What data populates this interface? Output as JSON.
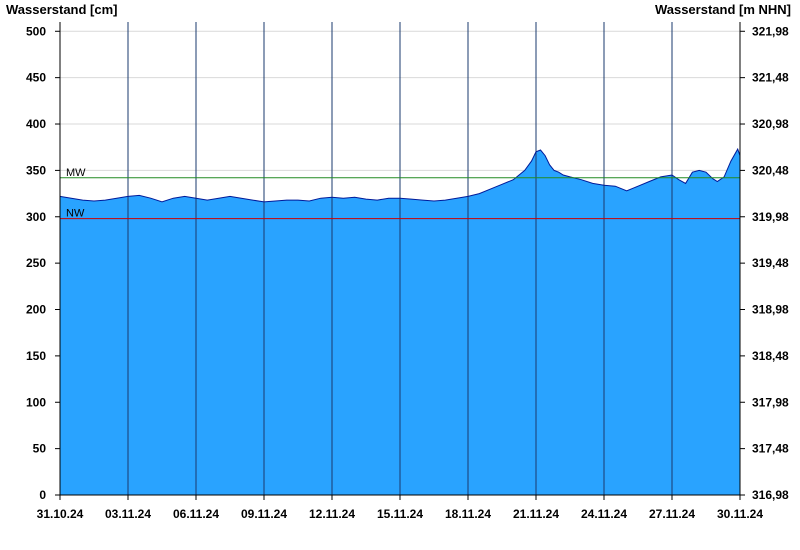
{
  "chart_data": {
    "type": "area",
    "y_left_label": "Wasserstand [cm]",
    "y_right_label": "Wasserstand [m NHN]",
    "ylim": [
      0,
      510
    ],
    "y_ticks": [
      0,
      50,
      100,
      150,
      200,
      250,
      300,
      350,
      400,
      450,
      500
    ],
    "y_ticks_labels": [
      "0",
      "50",
      "100",
      "150",
      "200",
      "250",
      "300",
      "350",
      "400",
      "450",
      "500"
    ],
    "y_right_ticks_labels": [
      "316,98",
      "317,48",
      "317,98",
      "318,48",
      "318,98",
      "319,48",
      "319,98",
      "320,48",
      "320,98",
      "321,48",
      "321,98"
    ],
    "x_start": "31.10.24",
    "x_days": 30,
    "x_tick_days": [
      0,
      3,
      6,
      9,
      12,
      15,
      18,
      21,
      24,
      27,
      30
    ],
    "x_ticks_labels": [
      "31.10.24",
      "03.11.24",
      "06.11.24",
      "09.11.24",
      "12.11.24",
      "15.11.24",
      "18.11.24",
      "21.11.24",
      "24.11.24",
      "27.11.24",
      "30.11.24"
    ],
    "grid": true,
    "fill_color": "#29a3ff",
    "line_color": "#001a99",
    "x": [
      0,
      0.5,
      1,
      1.5,
      2,
      2.5,
      3,
      3.5,
      4,
      4.5,
      5,
      5.5,
      6,
      6.5,
      7,
      7.5,
      8,
      8.5,
      9,
      9.5,
      10,
      10.5,
      11,
      11.5,
      12,
      12.5,
      13,
      13.5,
      14,
      14.5,
      15,
      15.5,
      16,
      16.5,
      17,
      17.5,
      18,
      18.5,
      19,
      19.5,
      20,
      20.5,
      20.8,
      21,
      21.2,
      21.4,
      21.6,
      21.8,
      22,
      22.2,
      22.5,
      23,
      23.5,
      24,
      24.5,
      25,
      25.5,
      26,
      26.5,
      27,
      27.3,
      27.6,
      27.9,
      28.2,
      28.5,
      28.8,
      29,
      29.3,
      29.6,
      29.9,
      30.2,
      30.5,
      30.8,
      30.9
    ],
    "values": [
      322,
      320,
      318,
      317,
      318,
      320,
      322,
      323,
      320,
      316,
      320,
      322,
      320,
      318,
      320,
      322,
      320,
      318,
      316,
      317,
      318,
      318,
      317,
      320,
      321,
      320,
      321,
      319,
      318,
      320,
      320,
      319,
      318,
      317,
      318,
      320,
      322,
      325,
      330,
      335,
      340,
      350,
      360,
      370,
      372,
      366,
      356,
      350,
      348,
      345,
      343,
      340,
      336,
      334,
      333,
      328,
      333,
      338,
      343,
      345,
      340,
      336,
      348,
      350,
      348,
      341,
      338,
      343,
      360,
      373,
      366,
      360,
      355,
      345
    ]
  },
  "reference_lines": {
    "mw": {
      "label": "MW",
      "value": 342,
      "color": "#228b22"
    },
    "nw": {
      "label": "NW",
      "value": 298,
      "color": "#cc0000"
    }
  }
}
